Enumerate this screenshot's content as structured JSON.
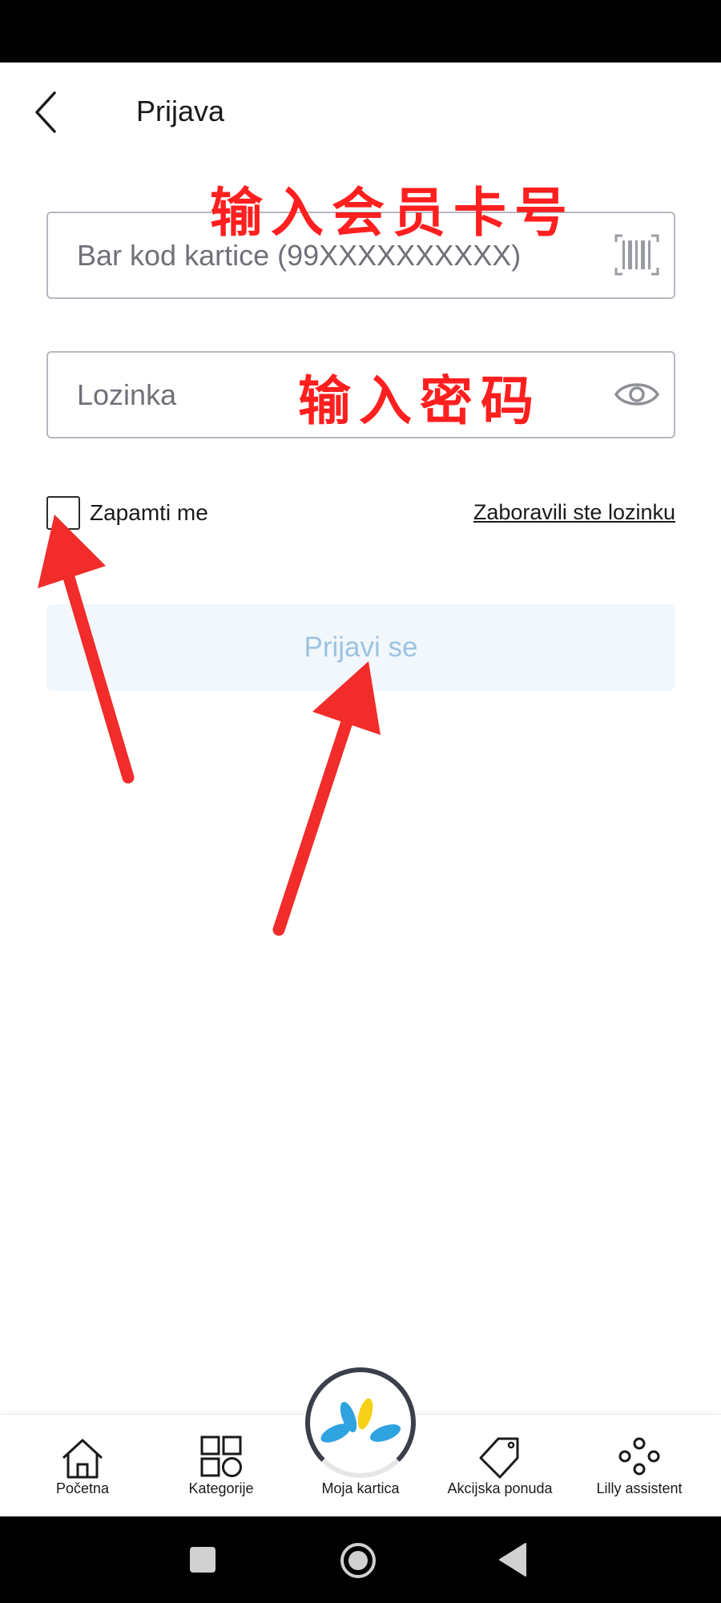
{
  "header": {
    "title": "Prijava"
  },
  "form": {
    "barcode_placeholder": "Bar kod kartice (99XXXXXXXXXX)",
    "password_placeholder": "Lozinka",
    "remember_label": "Zapamti me",
    "forgot_label": "Zaboravili ste lozinku",
    "login_label": "Prijavi se"
  },
  "annotations": {
    "barcode_note": "输入会员卡号",
    "password_note": "输入密码"
  },
  "bottom_nav": {
    "home": "Početna",
    "categories": "Kategorije",
    "card": "Moja kartica",
    "offers": "Akcijska ponuda",
    "assistant": "Lilly assistent"
  },
  "colors": {
    "annotation": "#ff1f1f",
    "login_button_bg": "#f2f7fc",
    "login_button_text": "#9cc3e3",
    "logo_blue": "#2fa3df",
    "logo_yellow": "#f7d117"
  },
  "icons": {
    "back": "chevron-left-icon",
    "barcode": "barcode-icon",
    "password_toggle": "eye-icon",
    "home": "home-icon",
    "categories": "grid-icon",
    "card": "brand-logo-icon",
    "offers": "tag-icon",
    "assistant": "dots-icon"
  }
}
